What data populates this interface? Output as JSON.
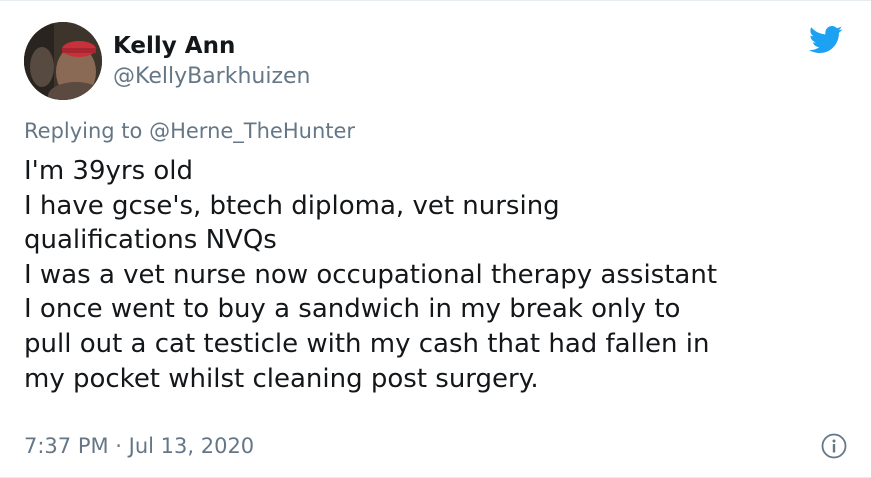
{
  "tweet": {
    "author_name": "Kelly Ann",
    "author_handle": "@KellyBarkhuizen",
    "reply_prefix": "Replying to",
    "reply_mention": "@Herne_TheHunter",
    "body_lines": [
      "I'm 39yrs old",
      "I have gcse's, btech diploma, vet nursing",
      "qualifications  NVQs",
      "I was a vet nurse now occupational therapy assistant",
      "I once went to buy a sandwich in my break only to",
      "pull out a cat testicle with my cash that had fallen in",
      "my pocket whilst cleaning post surgery."
    ],
    "timestamp": "7:37 PM · Jul 13, 2020"
  },
  "icons": {
    "brand": "twitter-bird-icon",
    "info": "info-icon"
  },
  "colors": {
    "twitter_blue": "#1da1f2",
    "secondary_text": "#657786",
    "primary_text": "#14171a"
  }
}
